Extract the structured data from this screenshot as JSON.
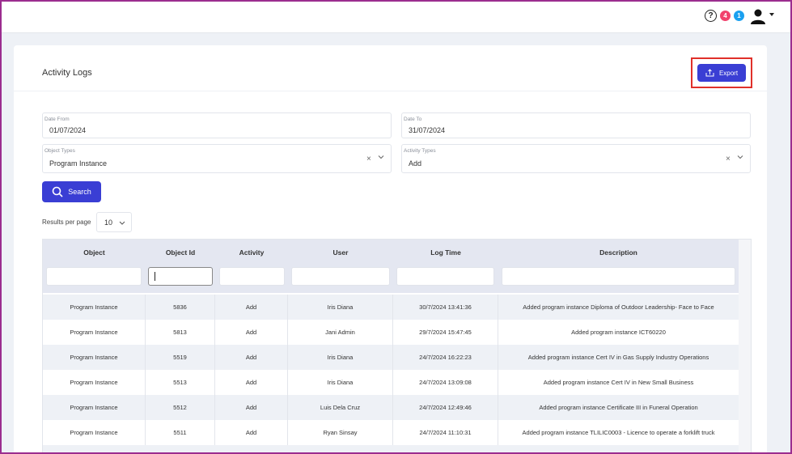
{
  "topbar": {
    "help_glyph": "?",
    "notifications_count": "4",
    "messages_count": "1",
    "icons": [
      "help-icon",
      "user-avatar-icon",
      "caret-down-icon"
    ]
  },
  "page": {
    "title": "Activity Logs",
    "export_label": "Export"
  },
  "filters": {
    "date_from": {
      "label": "Date From",
      "value": "01/07/2024"
    },
    "date_to": {
      "label": "Date To",
      "value": "31/07/2024"
    },
    "object_types": {
      "label": "Object Types",
      "value": "Program Instance",
      "clear": "×"
    },
    "activity_types": {
      "label": "Activity Types",
      "value": "Add",
      "clear": "×"
    },
    "search_label": "Search"
  },
  "pagination": {
    "results_per_page_label": "Results per page",
    "results_per_page_value": "10"
  },
  "table": {
    "columns": [
      "Object",
      "Object Id",
      "Activity",
      "User",
      "Log Time",
      "Description"
    ],
    "rows": [
      [
        "Program Instance",
        "5836",
        "Add",
        "Iris Diana",
        "30/7/2024 13:41:36",
        "Added program instance Diploma of Outdoor Leadership- Face to Face"
      ],
      [
        "Program Instance",
        "5813",
        "Add",
        "Jani Admin",
        "29/7/2024 15:47:45",
        "Added program instance ICT60220"
      ],
      [
        "Program Instance",
        "5519",
        "Add",
        "Iris Diana",
        "24/7/2024 16:22:23",
        "Added program instance Cert IV in Gas Supply Industry Operations"
      ],
      [
        "Program Instance",
        "5513",
        "Add",
        "Iris Diana",
        "24/7/2024 13:09:08",
        "Added program instance Cert IV in New Small Business"
      ],
      [
        "Program Instance",
        "5512",
        "Add",
        "Luis Dela Cruz",
        "24/7/2024 12:49:46",
        "Added program instance Certificate III in Funeral Operation"
      ],
      [
        "Program Instance",
        "5511",
        "Add",
        "Ryan Sinsay",
        "24/7/2024 11:10:31",
        "Added program instance TLILIC0003 - Licence to operate a forklift truck"
      ]
    ]
  },
  "colors": {
    "accent": "#3a3ed4",
    "badge_red": "#f1416c",
    "badge_blue": "#1aa0f0",
    "highlight": "#e0302a"
  }
}
